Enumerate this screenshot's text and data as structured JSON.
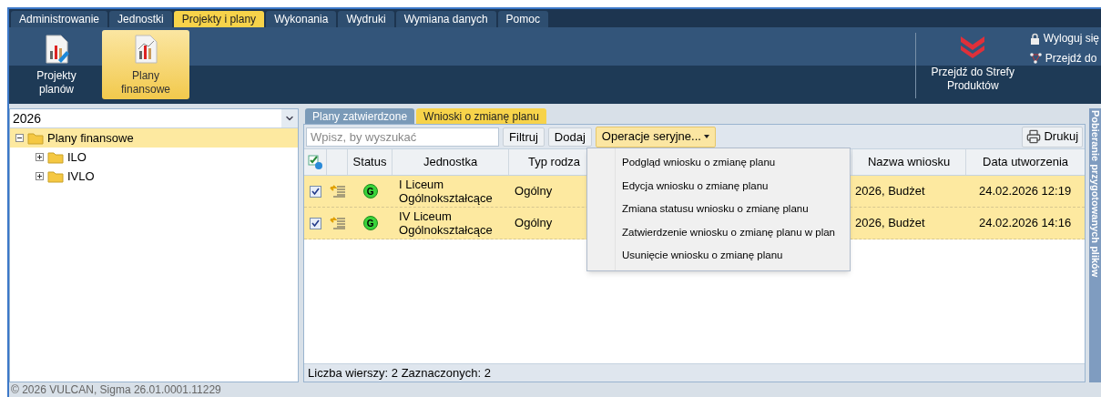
{
  "menu_tabs": [
    {
      "label": "Administrowanie",
      "selected": false
    },
    {
      "label": "Jednostki",
      "selected": false
    },
    {
      "label": "Projekty i plany",
      "selected": true
    },
    {
      "label": "Wykonania",
      "selected": false
    },
    {
      "label": "Wydruki",
      "selected": false
    },
    {
      "label": "Wymiana danych",
      "selected": false
    },
    {
      "label": "Pomoc",
      "selected": false
    }
  ],
  "ribbon": [
    {
      "label": "Projekty planów",
      "selected": false
    },
    {
      "label": "Plany finansowe",
      "selected": true
    }
  ],
  "products_link": "Przejdź do Strefy Produktów",
  "user_links": [
    {
      "kind": "logout",
      "label": "Wyloguj się"
    },
    {
      "kind": "goto",
      "label": "Przejdź do"
    }
  ],
  "year_select": {
    "value": "2026"
  },
  "tree": [
    {
      "label": "Plany finansowe",
      "expanded": true,
      "selected": true,
      "children": [
        {
          "label": "ILO",
          "expanded": false,
          "selected": false
        },
        {
          "label": "IVLO",
          "expanded": false,
          "selected": false
        }
      ]
    }
  ],
  "view_tabs": [
    {
      "label": "Plany zatwierdzone",
      "selected": false
    },
    {
      "label": "Wnioski o zmianę planu",
      "selected": true
    }
  ],
  "search": {
    "placeholder": "Wpisz, by wyszukać"
  },
  "toolbar": {
    "filter": "Filtruj",
    "add": "Dodaj",
    "batch": "Operacje seryjne...",
    "print": "Drukuj"
  },
  "table": {
    "columns": [
      "Status",
      "Jednostka",
      "Typ rodza",
      "Nazwa wniosku",
      "Data utworzenia"
    ],
    "rows": [
      {
        "checked": true,
        "selected": true,
        "status": "G",
        "unit": "I Liceum Ogólnokształcące",
        "type": "Ogólny",
        "name": "2026, Budżet",
        "created": "24.02.2026 12:19"
      },
      {
        "checked": true,
        "selected": true,
        "status": "G",
        "unit": "IV Liceum Ogólnokształcące",
        "type": "Ogólny",
        "name": "2026, Budżet",
        "created": "24.02.2026 14:16"
      }
    ]
  },
  "batch_menu": [
    "Podgląd wniosku o zmianę planu",
    "Edycja wniosku o zmianę planu",
    "Zmiana statusu wniosku o zmianę planu",
    "Zatwierdzenie wniosku o zmianę planu w plan",
    "Usunięcie wniosku o zmianę planu"
  ],
  "status_bar": "Liczba wierszy: 2 Zaznaczonych: 2",
  "side_panel": "Pobieranie przygotowanych plików",
  "footer": "© 2026 VULCAN, Sigma 26.01.0001.11229"
}
